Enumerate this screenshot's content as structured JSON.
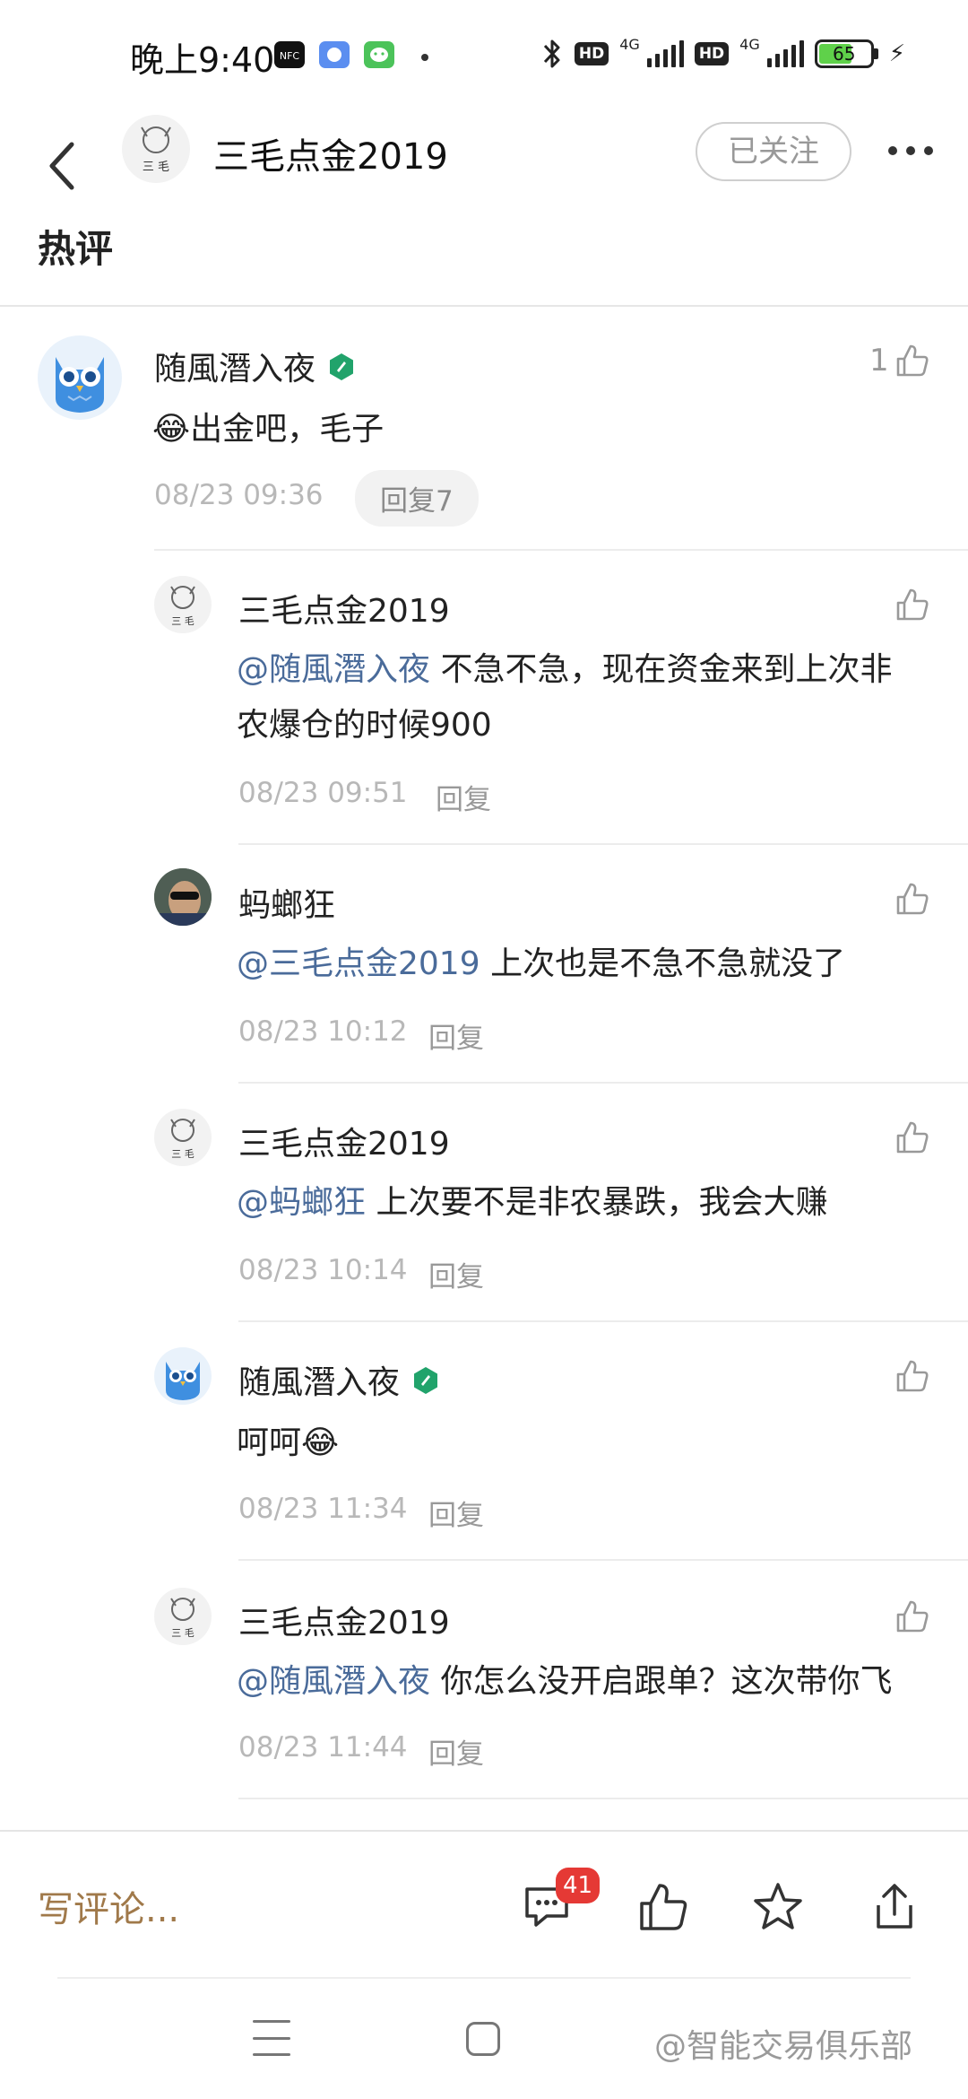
{
  "status_bar": {
    "time": "晚上9:40",
    "hd1": "HD",
    "hd2": "HD",
    "network1": "4G",
    "network2": "4G",
    "battery_level": "65",
    "icons": [
      "nfc-icon",
      "app-notification-icon",
      "wechat-icon",
      "bluetooth-icon",
      "signal-icon",
      "charging-icon"
    ]
  },
  "header": {
    "account_name": "三毛点金2019",
    "follow_label": "已关注",
    "icons": [
      "back-arrow-icon",
      "more-icon"
    ]
  },
  "section": {
    "title": "热评"
  },
  "comments": [
    {
      "name": "随風潛入夜",
      "verified": true,
      "emoji": "😂",
      "text": "出金吧，毛子",
      "time": "08/23 09:36",
      "reply_label": "回复7",
      "like_count": "1"
    }
  ],
  "replies": [
    {
      "name": "三毛点金2019",
      "mention": "@随風潛入夜",
      "text_line1": " 不急不急，现在资金来到上次非",
      "text_line2": "农爆仓的时候900",
      "time": "08/23 09:51",
      "reply_label": "回复"
    },
    {
      "name": "蚂螂狂",
      "mention": "@三毛点金2019",
      "text": " 上次也是不急不急就没了",
      "time": "08/23 10:12",
      "reply_label": "回复"
    },
    {
      "name": "三毛点金2019",
      "mention": "@蚂螂狂",
      "text": " 上次要不是非农暴跌，我会大赚",
      "time": "08/23 10:14",
      "reply_label": "回复"
    },
    {
      "name": "随風潛入夜",
      "verified": true,
      "text": "呵呵",
      "emoji": "😂",
      "time": "08/23 11:34",
      "reply_label": "回复"
    },
    {
      "name": "三毛点金2019",
      "mention": "@随風潛入夜",
      "text": " 你怎么没开启跟单？这次带你飞",
      "time": "08/23 11:44",
      "reply_label": "回复"
    }
  ],
  "bottom_bar": {
    "write_comment": "写评论...",
    "comment_count": "41",
    "icons": [
      "comment-icon",
      "like-icon",
      "star-icon",
      "share-icon"
    ]
  },
  "nav": {
    "watermark": "@智能交易俱乐部"
  },
  "colors": {
    "mention": "#4a6b9a",
    "write_comment": "#a0794a",
    "badge": "#e53935",
    "verified": "#21a36b",
    "owl": "#3f8fe0"
  }
}
